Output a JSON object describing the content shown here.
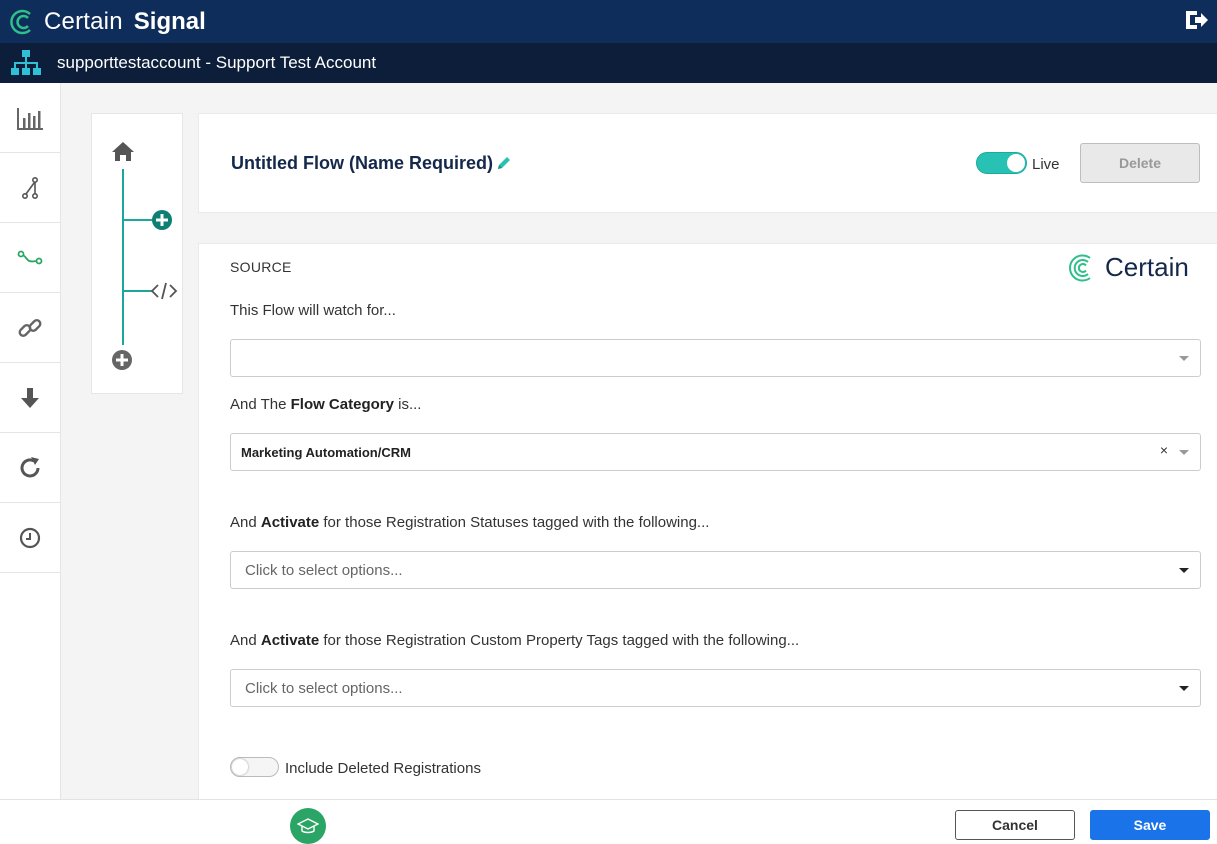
{
  "app": {
    "brand_word1": "Certain",
    "brand_word2": "Signal",
    "brand_logo_icon": "certain-c-logo-icon",
    "logout_icon": "logout-icon"
  },
  "account": {
    "label": "supporttestaccount - Support Test Account",
    "icon": "org-hierarchy-icon"
  },
  "sidebar": {
    "items": [
      {
        "name": "reports",
        "icon": "bar-chart-icon"
      },
      {
        "name": "flows",
        "icon": "branch-icon"
      },
      {
        "name": "routes",
        "icon": "route-icon",
        "active": true
      },
      {
        "name": "links",
        "icon": "link-icon"
      },
      {
        "name": "imports",
        "icon": "arrow-down-icon"
      },
      {
        "name": "refresh",
        "icon": "refresh-icon"
      },
      {
        "name": "history",
        "icon": "clock-icon"
      }
    ]
  },
  "flow_panel": {
    "home_icon": "home-icon",
    "add_step_icon": "plus-circle-icon",
    "code_icon": "code-icon",
    "add_end_icon": "plus-circle-icon"
  },
  "header": {
    "title": "Untitled Flow (Name Required)",
    "live_label": "Live",
    "live_on": true,
    "delete_label": "Delete"
  },
  "form": {
    "source_label": "SOURCE",
    "logo_text": "Certain",
    "watch_label": "This Flow will watch for...",
    "watch_value": "",
    "category_prefix": "And The ",
    "category_bold": "Flow Category",
    "category_suffix": " is...",
    "category_value": "Marketing Automation/CRM",
    "category_clear": "×",
    "status_prefix": "And ",
    "status_bold": "Activate",
    "status_suffix": " for those Registration Statuses tagged with the following...",
    "status_placeholder": "Click to select options...",
    "tags_prefix": "And ",
    "tags_bold": "Activate",
    "tags_suffix": " for those Registration Custom Property Tags tagged with the following...",
    "tags_placeholder": "Click to select options...",
    "include_deleted_label": "Include Deleted Registrations",
    "include_deleted_on": false
  },
  "footer": {
    "help_icon": "graduation-cap-icon",
    "cancel_label": "Cancel",
    "save_label": "Save"
  },
  "colors": {
    "topbar": "#0f2d5a",
    "accountbar": "#0c1e39",
    "teal": "#27c2b3",
    "save": "#1a73e8",
    "green": "#2ba566"
  }
}
